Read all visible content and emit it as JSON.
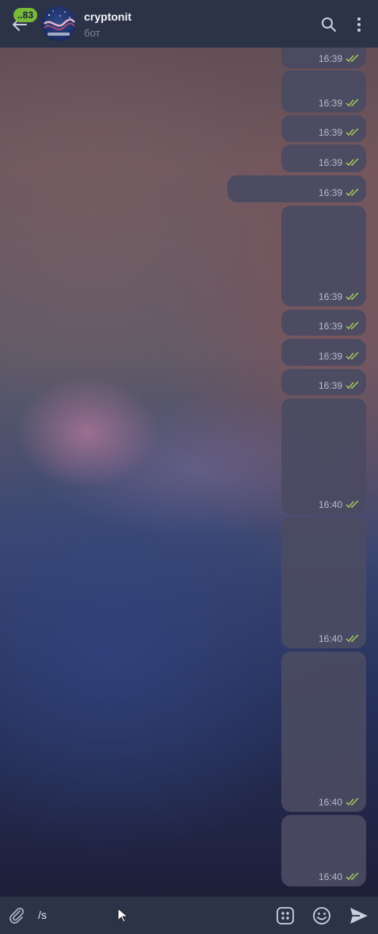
{
  "header": {
    "unread_count": "..83",
    "title": "cryptonit",
    "subtitle": "бот"
  },
  "messages": [
    {
      "time": "16:39"
    },
    {
      "time": "16:39"
    },
    {
      "time": "16:39"
    },
    {
      "time": "16:39"
    },
    {
      "time": "16:39"
    },
    {
      "time": "16:39"
    },
    {
      "time": "16:39"
    },
    {
      "time": "16:39"
    },
    {
      "time": "16:39"
    },
    {
      "time": "16:40"
    },
    {
      "time": "16:40"
    },
    {
      "time": "16:40"
    },
    {
      "time": "16:40"
    }
  ],
  "composer": {
    "input_value": "/s"
  },
  "colors": {
    "header_bg": "#2c3347",
    "bubble_bg": "#4a4a62",
    "badge": "#79b93a",
    "read_check": "#9fcb5b"
  }
}
